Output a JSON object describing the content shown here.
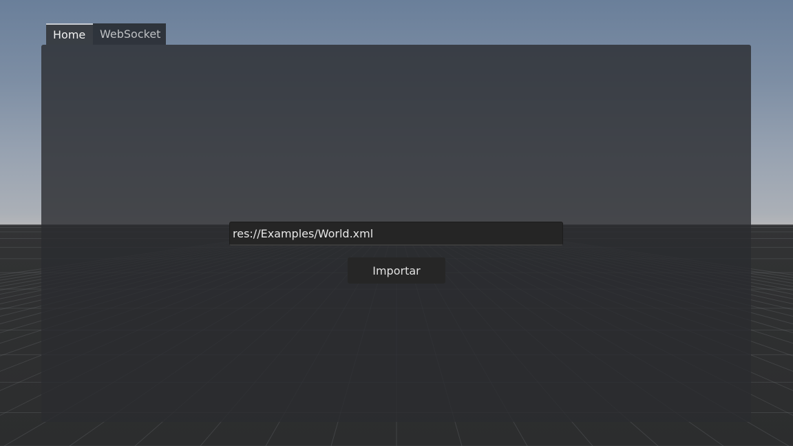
{
  "tabs": [
    {
      "label": "Home",
      "active": true
    },
    {
      "label": "WebSocket",
      "active": false
    }
  ],
  "path_input": {
    "value": "res://Examples/World.xml"
  },
  "import_button": {
    "label": "Importar"
  },
  "colors": {
    "sky_top": "#6a7f9a",
    "horizon": "#b5b6b8",
    "ground": "#2f3031",
    "panel": "#2a2c30"
  }
}
